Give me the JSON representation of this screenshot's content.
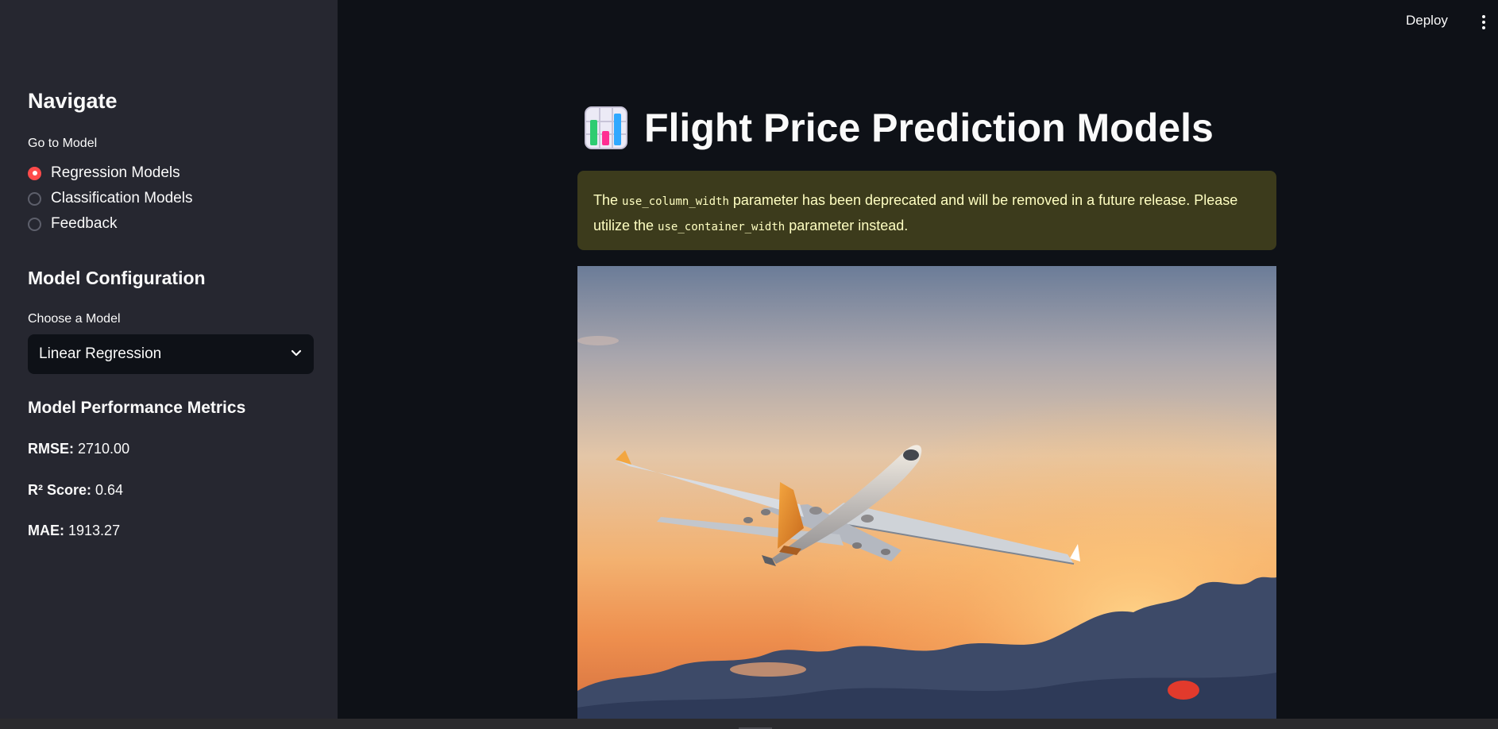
{
  "sidebar": {
    "heading": "Navigate",
    "nav_label": "Go to Model",
    "nav_options": [
      {
        "label": "Regression Models",
        "selected": true
      },
      {
        "label": "Classification Models",
        "selected": false
      },
      {
        "label": "Feedback",
        "selected": false
      }
    ],
    "config_heading": "Model Configuration",
    "model_label": "Choose a Model",
    "model_selected": "Linear Regression",
    "metrics_heading": "Model Performance Metrics",
    "metrics": [
      {
        "label": "RMSE:",
        "value": "2710.00"
      },
      {
        "label": "R² Score:",
        "value": "0.64"
      },
      {
        "label": "MAE:",
        "value": "1913.27"
      }
    ]
  },
  "toolbar": {
    "deploy_label": "Deploy",
    "menu_icon": "kebab-menu-icon"
  },
  "main": {
    "title_icon": "bar-chart-emoji-icon",
    "title": "Flight Price Prediction Models",
    "warning": {
      "prefix": "The ",
      "code1": "use_column_width",
      "middle": " parameter has been deprecated and will be removed in a future release. Please utilize the ",
      "code2": "use_container_width",
      "suffix": " parameter instead."
    },
    "hero_image": "airplane-sunset-image"
  },
  "colors": {
    "accent": "#ff4b4b",
    "sidebar_bg": "#262730",
    "main_bg": "#0e1117",
    "warning_bg": "#3c3b1c",
    "warning_text": "#ffffc2"
  }
}
